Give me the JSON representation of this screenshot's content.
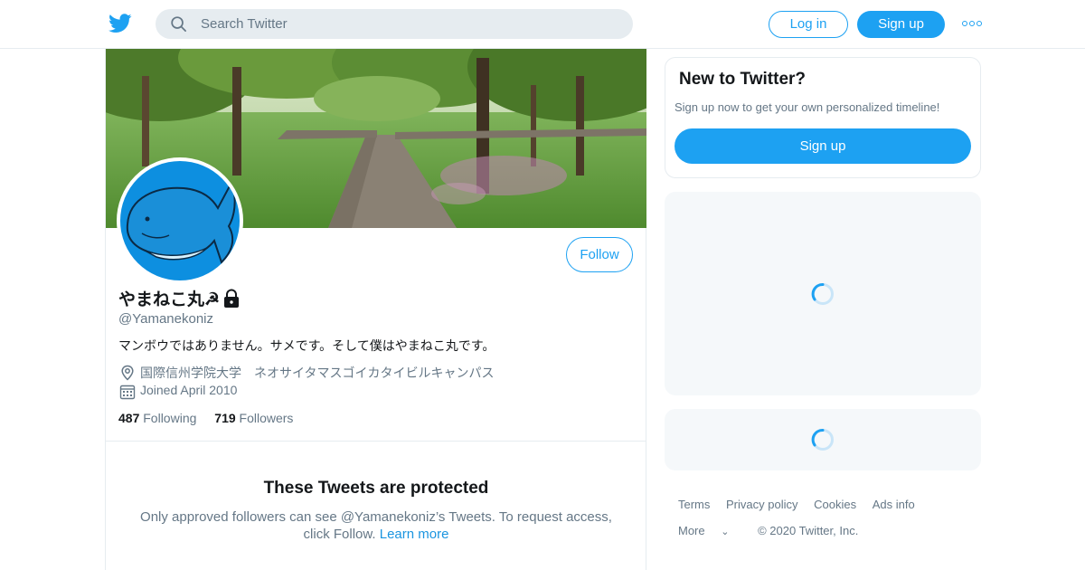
{
  "nav": {
    "search_placeholder": "Search Twitter",
    "login_label": "Log in",
    "signup_label": "Sign up",
    "icons": [
      "twitter-bird-icon",
      "search-icon",
      "more-icon"
    ]
  },
  "profile": {
    "display_name": "やまねこ丸☭",
    "handle": "@Yamanekoniz",
    "bio": "マンボウではありません。サメです。そして僕はやまねこ丸です。",
    "location": "国際信州学院大学　ネオサイタマスゴイカタイビルキャンパス",
    "joined": "Joined April 2010",
    "following_count": "487",
    "following_label": "Following",
    "followers_count": "719",
    "followers_label": "Followers",
    "follow_button": "Follow",
    "protected": true
  },
  "protected_notice": {
    "title": "These Tweets are protected",
    "text": "Only approved followers can see @Yamanekoniz’s Tweets. To request access, click Follow.",
    "link": "Learn more"
  },
  "sidebar": {
    "signup_card": {
      "title": "New to Twitter?",
      "subtitle": "Sign up now to get your own personalized timeline!",
      "button": "Sign up"
    }
  },
  "footer": {
    "links": [
      "Terms",
      "Privacy policy",
      "Cookies",
      "Ads info"
    ],
    "more": "More",
    "copyright": "© 2020 Twitter, Inc."
  },
  "colors": {
    "brand": "#1da1f2",
    "secondary_text": "#657786",
    "border": "#e6ecf0",
    "card_bg": "#f5f8fa"
  }
}
